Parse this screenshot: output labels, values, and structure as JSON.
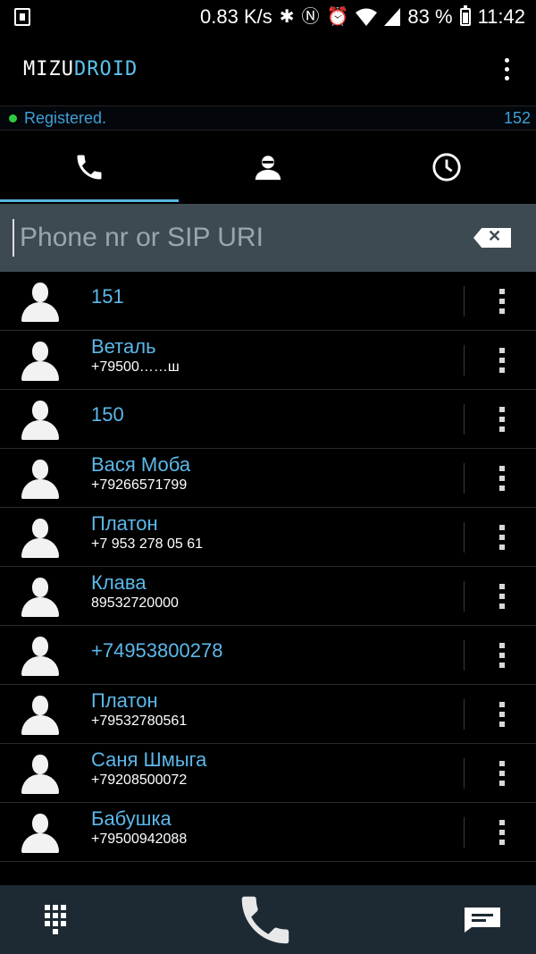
{
  "status_bar": {
    "speed": "0.83 K/s",
    "battery": "83 %",
    "time": "11:42"
  },
  "app": {
    "logo_part1": "MIZU",
    "logo_part2": "DROID"
  },
  "registration": {
    "status": "Registered.",
    "extension": "152"
  },
  "tabs": [
    {
      "icon": "phone-icon",
      "active": true
    },
    {
      "icon": "contacts-icon",
      "active": false
    },
    {
      "icon": "history-icon",
      "active": false
    }
  ],
  "search": {
    "placeholder": "Phone nr or SIP URI",
    "value": ""
  },
  "contacts": [
    {
      "name": "151",
      "number": ""
    },
    {
      "name": "Веталь",
      "number": "+79500……ш"
    },
    {
      "name": "150",
      "number": ""
    },
    {
      "name": "Вася Моба",
      "number": "+79266571799"
    },
    {
      "name": "Платон",
      "number": "+7 953 278 05 61"
    },
    {
      "name": "Клава",
      "number": "89532720000"
    },
    {
      "name": "+74953800278",
      "number": ""
    },
    {
      "name": "Платон",
      "number": "+79532780561"
    },
    {
      "name": "Саня Шмыга",
      "number": "+79208500072"
    },
    {
      "name": "Бабушка",
      "number": "+79500942088"
    }
  ],
  "colors": {
    "accent": "#5cb8ea",
    "search_bg": "#3e4a52",
    "bottom_bar": "#1d2a33",
    "registered_dot": "#2ecc40"
  }
}
